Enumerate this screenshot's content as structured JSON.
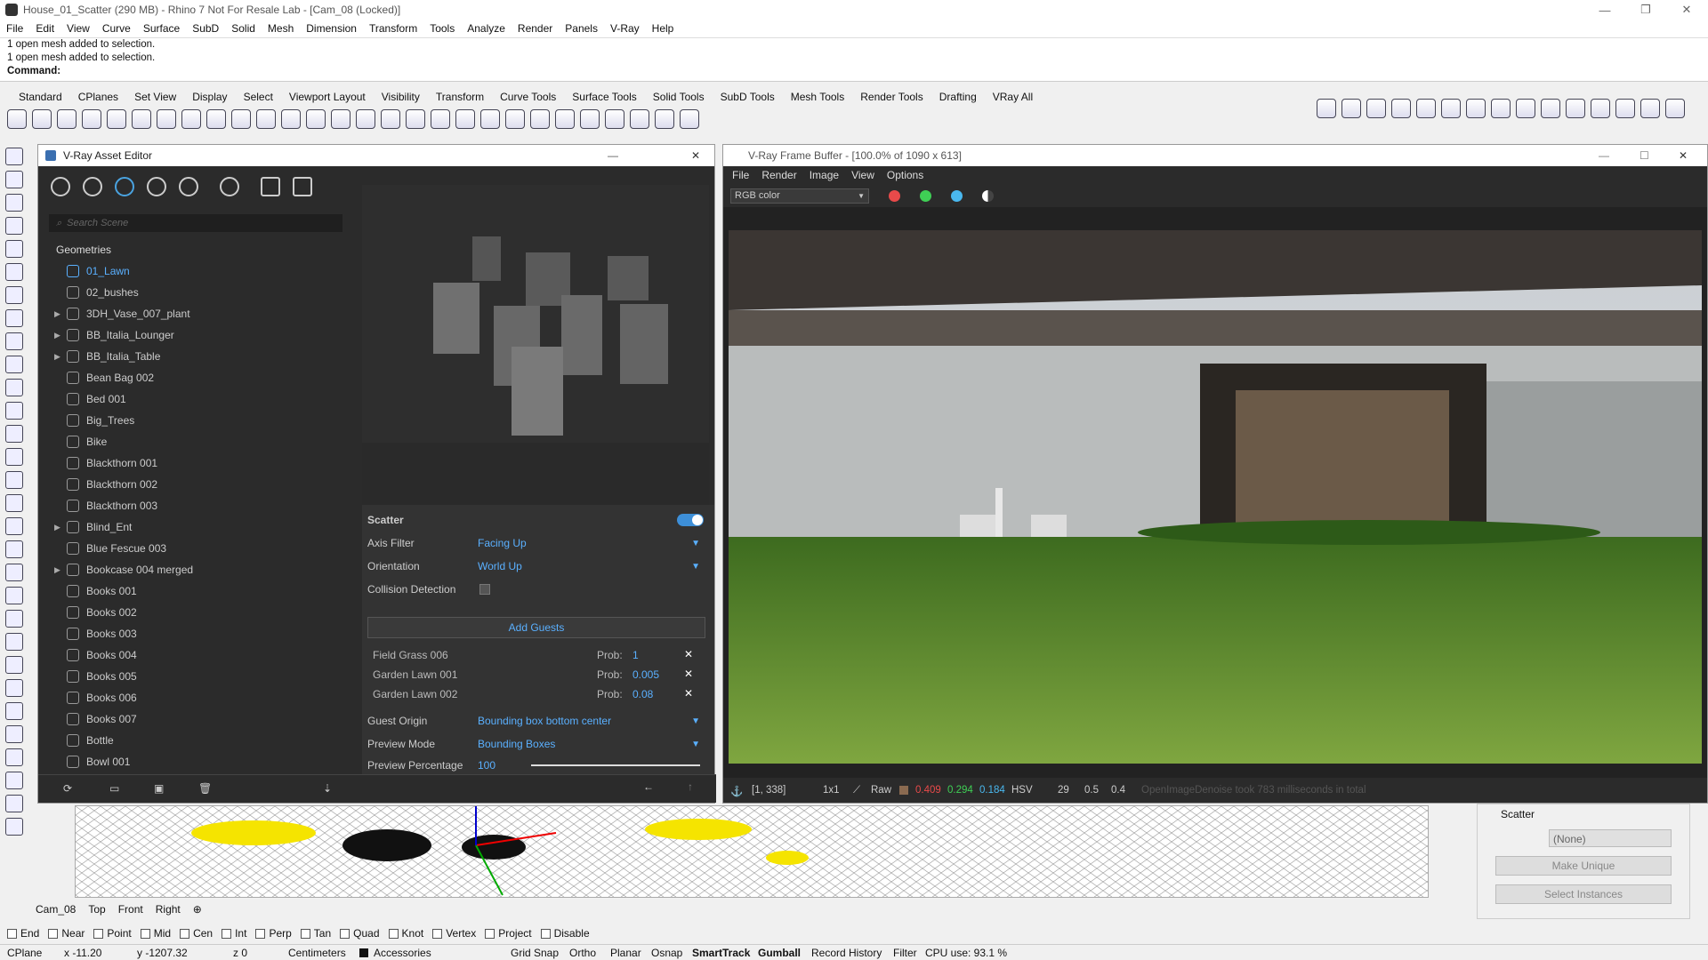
{
  "window": {
    "title": "House_01_Scatter (290 MB) - Rhino 7 Not For Resale Lab - [Cam_08 (Locked)]"
  },
  "menu": [
    "File",
    "Edit",
    "View",
    "Curve",
    "Surface",
    "SubD",
    "Solid",
    "Mesh",
    "Dimension",
    "Transform",
    "Tools",
    "Analyze",
    "Render",
    "Panels",
    "V-Ray",
    "Help"
  ],
  "command": {
    "line1": "1 open mesh added to selection.",
    "line2": "1 open mesh added to selection.",
    "prompt": "Command:"
  },
  "toolbar_tabs": [
    "Standard",
    "CPlanes",
    "Set View",
    "Display",
    "Select",
    "Viewport Layout",
    "Visibility",
    "Transform",
    "Curve Tools",
    "Surface Tools",
    "Solid Tools",
    "SubD Tools",
    "Mesh Tools",
    "Render Tools",
    "Drafting",
    "VRay All"
  ],
  "asset_editor": {
    "title": "V-Ray Asset Editor",
    "search_placeholder": "Search Scene",
    "section": "Geometries",
    "items": [
      {
        "label": "01_Lawn",
        "selected": true,
        "expand": false
      },
      {
        "label": "02_bushes",
        "selected": false,
        "expand": false
      },
      {
        "label": "3DH_Vase_007_plant",
        "selected": false,
        "expand": true
      },
      {
        "label": "BB_Italia_Lounger",
        "selected": false,
        "expand": true
      },
      {
        "label": "BB_Italia_Table",
        "selected": false,
        "expand": true
      },
      {
        "label": "Bean Bag 002",
        "selected": false,
        "expand": false
      },
      {
        "label": "Bed 001",
        "selected": false,
        "expand": false
      },
      {
        "label": "Big_Trees",
        "selected": false,
        "expand": false
      },
      {
        "label": "Bike",
        "selected": false,
        "expand": false
      },
      {
        "label": "Blackthorn 001",
        "selected": false,
        "expand": false
      },
      {
        "label": "Blackthorn 002",
        "selected": false,
        "expand": false
      },
      {
        "label": "Blackthorn 003",
        "selected": false,
        "expand": false
      },
      {
        "label": "Blind_Ent",
        "selected": false,
        "expand": true
      },
      {
        "label": "Blue Fescue 003",
        "selected": false,
        "expand": false
      },
      {
        "label": "Bookcase 004 merged",
        "selected": false,
        "expand": true
      },
      {
        "label": "Books 001",
        "selected": false,
        "expand": false
      },
      {
        "label": "Books 002",
        "selected": false,
        "expand": false
      },
      {
        "label": "Books 003",
        "selected": false,
        "expand": false
      },
      {
        "label": "Books 004",
        "selected": false,
        "expand": false
      },
      {
        "label": "Books 005",
        "selected": false,
        "expand": false
      },
      {
        "label": "Books 006",
        "selected": false,
        "expand": false
      },
      {
        "label": "Books 007",
        "selected": false,
        "expand": false
      },
      {
        "label": "Bottle",
        "selected": false,
        "expand": false
      },
      {
        "label": "Bowl 001",
        "selected": false,
        "expand": false
      }
    ],
    "scatter": {
      "title": "Scatter",
      "enabled": true,
      "axis_filter_label": "Axis Filter",
      "axis_filter": "Facing Up",
      "orientation_label": "Orientation",
      "orientation": "World Up",
      "collision_label": "Collision Detection",
      "add_guests": "Add Guests",
      "guests": [
        {
          "name": "Field Grass 006",
          "prob_label": "Prob:",
          "prob": "1"
        },
        {
          "name": "Garden Lawn 001",
          "prob_label": "Prob:",
          "prob": "0.005"
        },
        {
          "name": "Garden Lawn 002",
          "prob_label": "Prob:",
          "prob": "0.08"
        }
      ],
      "guest_origin_label": "Guest Origin",
      "guest_origin": "Bounding box bottom center",
      "preview_mode_label": "Preview Mode",
      "preview_mode": "Bounding Boxes",
      "preview_pct_label": "Preview Percentage",
      "preview_pct": "100"
    }
  },
  "frame_buffer": {
    "title": "V-Ray Frame Buffer - [100.0% of 1090 x 613]",
    "menu": [
      "File",
      "Render",
      "Image",
      "View",
      "Options"
    ],
    "channel": "RGB color",
    "status": {
      "coords": "[1, 338]",
      "zoom": "1x1",
      "raw": "Raw",
      "r": "0.409",
      "g": "0.294",
      "b": "0.184",
      "mode": "HSV",
      "h": "29",
      "s": "0.5",
      "v": "0.4",
      "message": "OpenImageDenoise took 783 milliseconds in total"
    }
  },
  "viewport_tabs": [
    "Cam_08",
    "Top",
    "Front",
    "Right"
  ],
  "osnaps": [
    "End",
    "Near",
    "Point",
    "Mid",
    "Cen",
    "Int",
    "Perp",
    "Tan",
    "Quad",
    "Knot",
    "Vertex",
    "Project",
    "Disable"
  ],
  "statusbar": {
    "cplane": "CPlane",
    "x": "x -11.20",
    "y": "y -1207.32",
    "z": "z 0",
    "units": "Centimeters",
    "layer": "Accessories",
    "grid_snap": "Grid Snap",
    "ortho": "Ortho",
    "planar": "Planar",
    "osnap": "Osnap",
    "smarttrack": "SmartTrack",
    "gumball": "Gumball",
    "record": "Record History",
    "filter": "Filter",
    "cpu": "CPU use: 93.1 %"
  },
  "right_panel": {
    "section": "Scatter",
    "select": "(None)",
    "make_unique": "Make Unique",
    "select_instances": "Select Instances"
  }
}
